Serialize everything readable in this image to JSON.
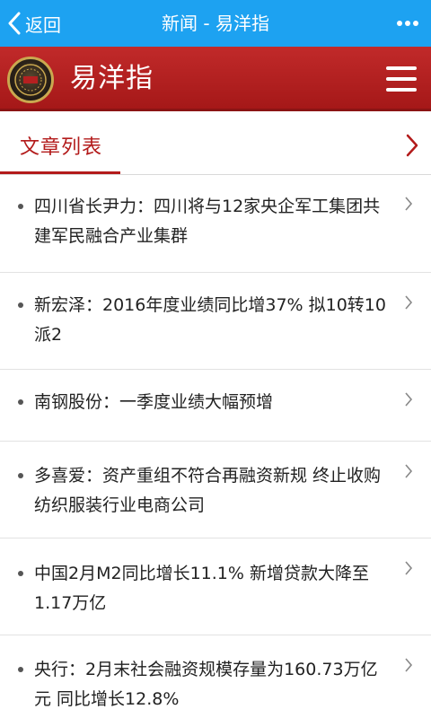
{
  "topbar": {
    "back_label": "返回",
    "title": "新闻 - 易洋指"
  },
  "brand": {
    "name": "易洋指",
    "logo_text": "易洋指"
  },
  "section": {
    "title": "文章列表"
  },
  "articles": [
    {
      "title": "四川省长尹力：四川将与12家央企军工集团共建军民融合产业集群"
    },
    {
      "title": "新宏泽：2016年度业绩同比增37% 拟10转10派2"
    },
    {
      "title": "南钢股份：一季度业绩大幅预增"
    },
    {
      "title": "多喜爱：资产重组不符合再融资新规 终止收购纺织服装行业电商公司"
    },
    {
      "title": "中国2月M2同比增长11.1% 新增贷款大降至1.17万亿"
    },
    {
      "title": "央行：2月末社会融资规模存量为160.73万亿元 同比增长12.8%"
    }
  ],
  "colors": {
    "topbar": "#1da2f1",
    "brandbar": "#b52020",
    "accent": "#b31b1b"
  }
}
